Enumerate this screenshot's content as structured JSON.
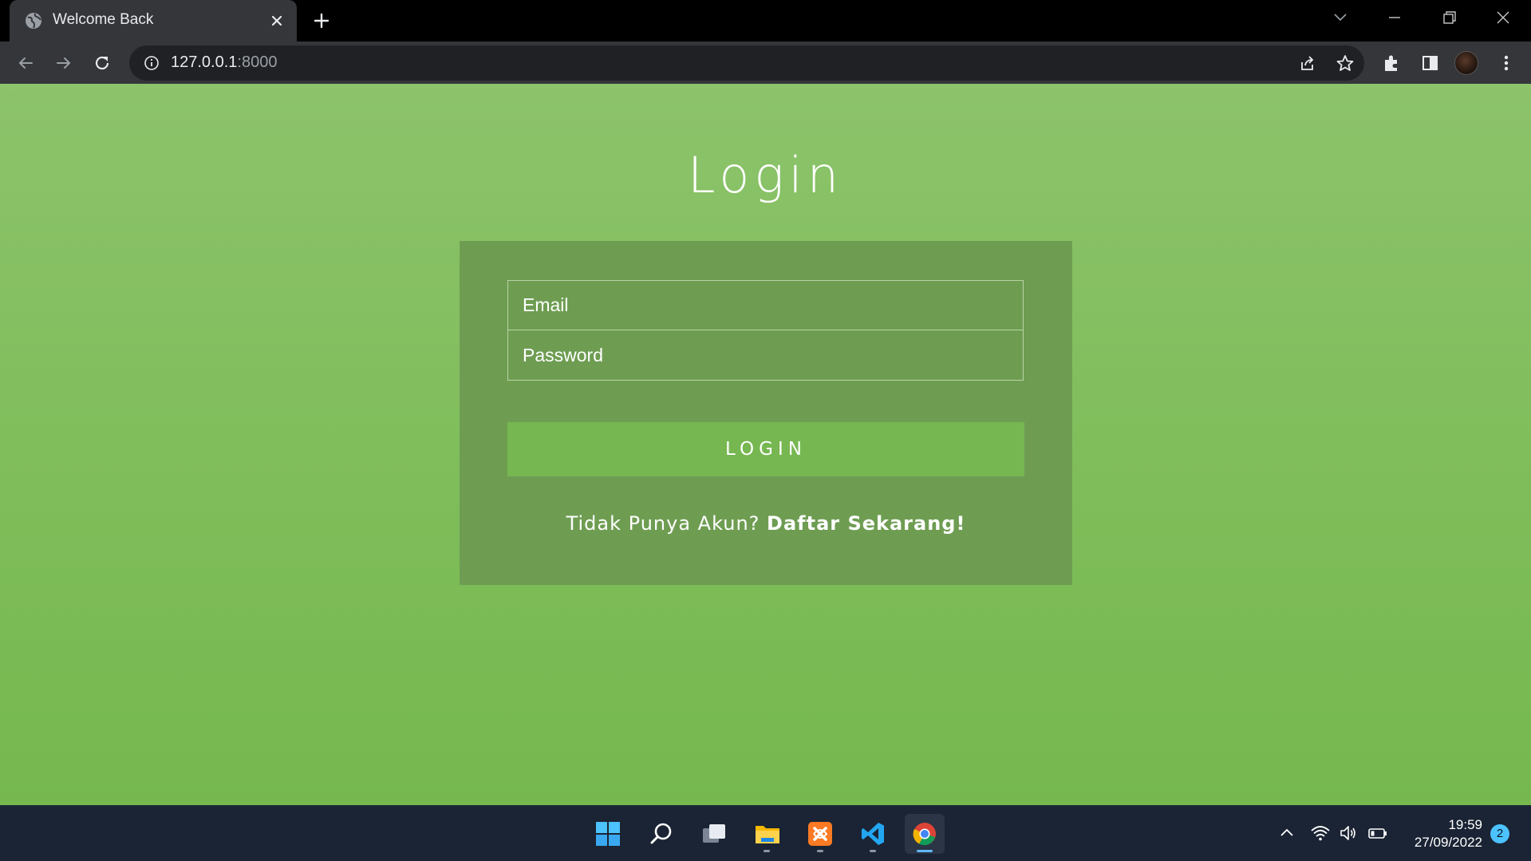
{
  "browser": {
    "tab": {
      "title": "Welcome Back",
      "favicon": "globe-icon"
    },
    "omnibox": {
      "host": "127.0.0.1",
      "port": ":8000"
    }
  },
  "page": {
    "title": "Login",
    "form": {
      "email_placeholder": "Email",
      "password_placeholder": "Password",
      "submit_label": "LOGIN"
    },
    "signup": {
      "prompt": "Tidak Punya Akun?",
      "link_label": "Daftar Sekarang!"
    }
  },
  "taskbar": {
    "apps": [
      "windows-start-icon",
      "search-icon",
      "task-view-icon",
      "file-explorer-icon",
      "xampp-icon",
      "vscode-icon",
      "chrome-icon"
    ],
    "clock": {
      "time": "19:59",
      "date": "27/09/2022"
    },
    "notifications": "2"
  },
  "colors": {
    "background_top": "#8cc36b",
    "background_bottom": "#76b84f",
    "card": "#6e9d52",
    "button": "#76b751",
    "text": "#ffffff"
  }
}
